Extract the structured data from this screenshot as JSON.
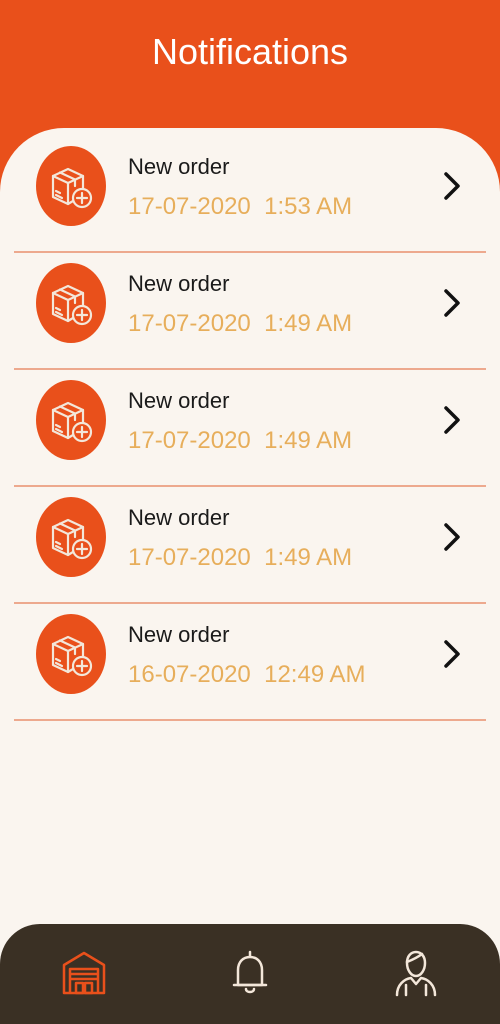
{
  "header": {
    "title": "Notifications"
  },
  "notifications": [
    {
      "title": "New order",
      "timestamp": "17-07-2020  1:53 AM",
      "icon": "box-plus-icon"
    },
    {
      "title": "New order",
      "timestamp": "17-07-2020  1:49 AM",
      "icon": "box-plus-icon"
    },
    {
      "title": "New order",
      "timestamp": "17-07-2020  1:49 AM",
      "icon": "box-plus-icon"
    },
    {
      "title": "New order",
      "timestamp": "17-07-2020  1:49 AM",
      "icon": "box-plus-icon"
    },
    {
      "title": "New order",
      "timestamp": "16-07-2020  12:49 AM",
      "icon": "box-plus-icon"
    }
  ],
  "bottom_nav": {
    "items": [
      {
        "icon": "warehouse-icon",
        "active": true
      },
      {
        "icon": "bell-icon",
        "active": false
      },
      {
        "icon": "user-icon",
        "active": false
      }
    ]
  },
  "colors": {
    "accent": "#E9501B",
    "background": "#FAF5EF",
    "timestamp": "#E7AE5B",
    "divider": "#EDA98E",
    "nav_background": "#3A3024",
    "nav_icon": "#F3E7DA"
  }
}
